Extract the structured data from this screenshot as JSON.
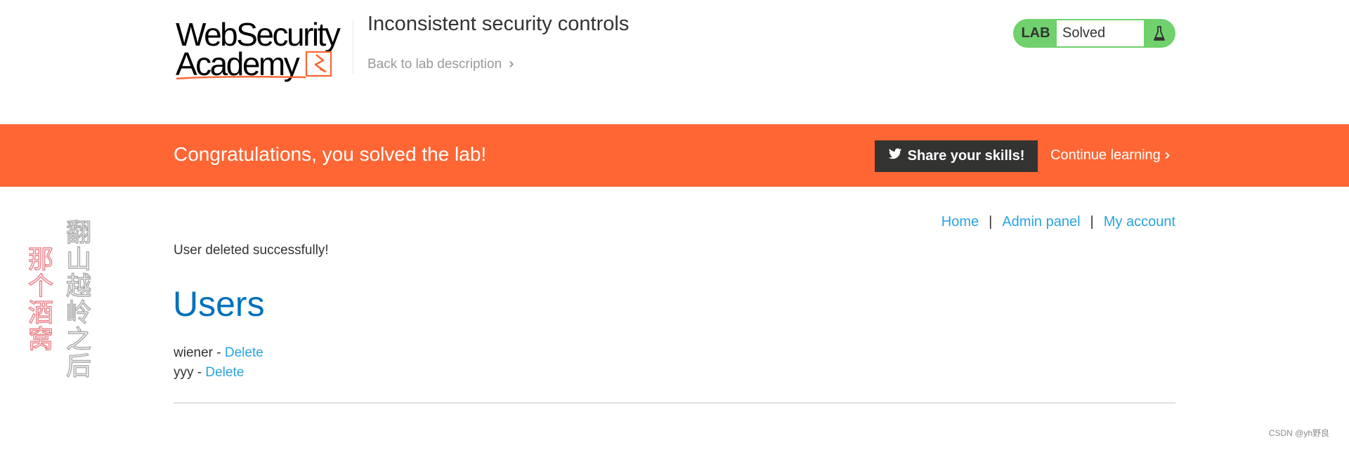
{
  "header": {
    "logo_line1": "WebSecurity",
    "logo_line2": "Academy",
    "lab_title": "Inconsistent security controls",
    "back_link": "Back to lab description",
    "lab_status": {
      "tag": "LAB",
      "state": "Solved"
    }
  },
  "banner": {
    "message": "Congratulations, you solved the lab!",
    "share_label": "Share your skills!",
    "continue_label": "Continue learning"
  },
  "side_text": {
    "col_red": "那个酒窝",
    "col_gray": "翻山越岭之后"
  },
  "nav": {
    "home": "Home",
    "admin": "Admin panel",
    "account": "My account",
    "separator": "|"
  },
  "notice": "User deleted successfully!",
  "users": {
    "title": "Users",
    "rows": [
      {
        "name": "wiener",
        "sep": " - ",
        "action": "Delete"
      },
      {
        "name": "yyy",
        "sep": " - ",
        "action": "Delete"
      }
    ]
  },
  "watermark": "CSDN @yh野良",
  "colors": {
    "accent": "#ff6633",
    "link": "#29a3e0",
    "title_blue": "#0071bc",
    "status_green": "#70d16d",
    "dark_button": "#333332"
  }
}
